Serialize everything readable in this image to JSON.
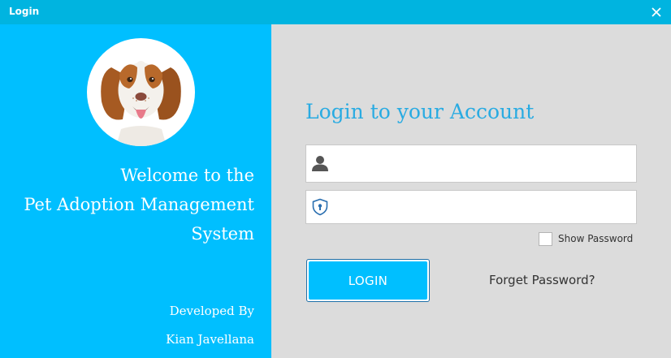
{
  "window": {
    "title": "Login",
    "close_icon": "close-icon",
    "titlebar_color": "#00b4e0"
  },
  "left_panel": {
    "background_color": "#00bfff",
    "avatar": "dog-avatar",
    "welcome_lines": [
      "Welcome to the",
      "Pet Adoption Management",
      "System"
    ],
    "developed_by_label": "Developed By",
    "developer_name": "Kian Javellana"
  },
  "login_form": {
    "heading": "Login to your Account",
    "heading_color": "#29abe2",
    "username": {
      "icon": "user-icon",
      "value": "",
      "placeholder": ""
    },
    "password": {
      "icon": "shield-lock-icon",
      "value": "",
      "placeholder": ""
    },
    "show_password": {
      "label": "Show Password",
      "checked": false
    },
    "login_button_label": "LOGIN",
    "forget_password_label": "Forget Password?"
  }
}
